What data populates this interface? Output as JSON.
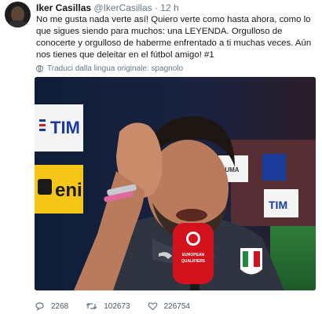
{
  "tweet": {
    "user_name": "Iker Casillas",
    "handle": "@IkerCasillas",
    "separator": "·",
    "time": "12 h",
    "text": "No me gusta nada verte así! Quiero verte como hasta ahora, como lo que sigues siendo para muchos: una LEYENDA. Orgulloso de conocerte y orgulloso de haberme enfrentado a ti muchas veces. Aún nos tienes que deleitar en el fútbol amigo! #1",
    "translate_label": "Traduci dalla lingua originale: spagnolo",
    "media": {
      "board_text_1": "TIM",
      "board_text_2": "eni",
      "board_text_3": "TIM",
      "board_text_4": "PUMA",
      "mic_text_1": "EUROPEAN",
      "mic_text_2": "QUALIFIERS"
    },
    "actions": {
      "replies": "2268",
      "retweets": "102673",
      "likes": "226754"
    }
  }
}
